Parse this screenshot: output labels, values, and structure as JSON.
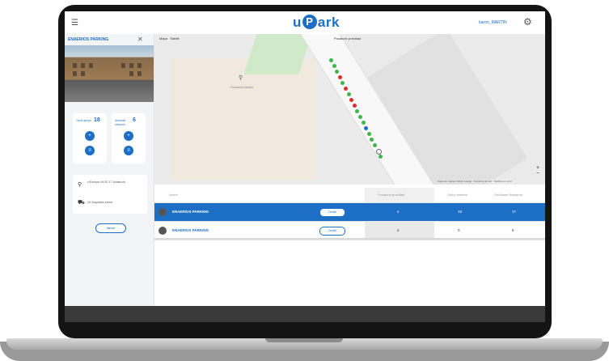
{
  "app": {
    "logo_left": "u",
    "logo_p": "P",
    "logo_right": "ark",
    "user": "baron_MARTIN",
    "menu_icon": "hamburger-icon",
    "settings_icon": "gear-icon"
  },
  "sidebar": {
    "title": "ENAERIOS PARKING",
    "stats": [
      {
        "label": "Ocuit apoyo",
        "value": "18"
      },
      {
        "label": "Aeredad ubicacio",
        "value": "6"
      }
    ],
    "address": "c/Enrique 4/4 87-17 Andalucia",
    "capacity": "16 Ocupados ahora",
    "button": "Ilamarl"
  },
  "map": {
    "tab_map": "Mapa",
    "tab_satellite": "Satélit",
    "dropdown": "Pocatorio prezidad",
    "poi_label": "Fundación Madrid",
    "zoom_in": "+",
    "zoom_out": "−",
    "attribution": "Datos de mapas ©2021 Google · Términos de uso · Notificar un error"
  },
  "table": {
    "headers": [
      "Nome",
      "Pocatorio prezidad",
      "Ochot mesma",
      "Ondlamet Naparma"
    ],
    "rows": [
      {
        "name": "ENAERIOS PARKING",
        "detail": "Detalli",
        "c1": "4",
        "c2": "18",
        "c3": "17",
        "selected": true
      },
      {
        "name": "ENAERIOS PARKING",
        "detail": "Detalli",
        "c1": "2",
        "c2": "0",
        "c3": "6",
        "selected": false
      }
    ]
  },
  "colors": {
    "accent": "#1c6fc4",
    "occupied": "#d9302c",
    "free": "#3cb54a"
  }
}
